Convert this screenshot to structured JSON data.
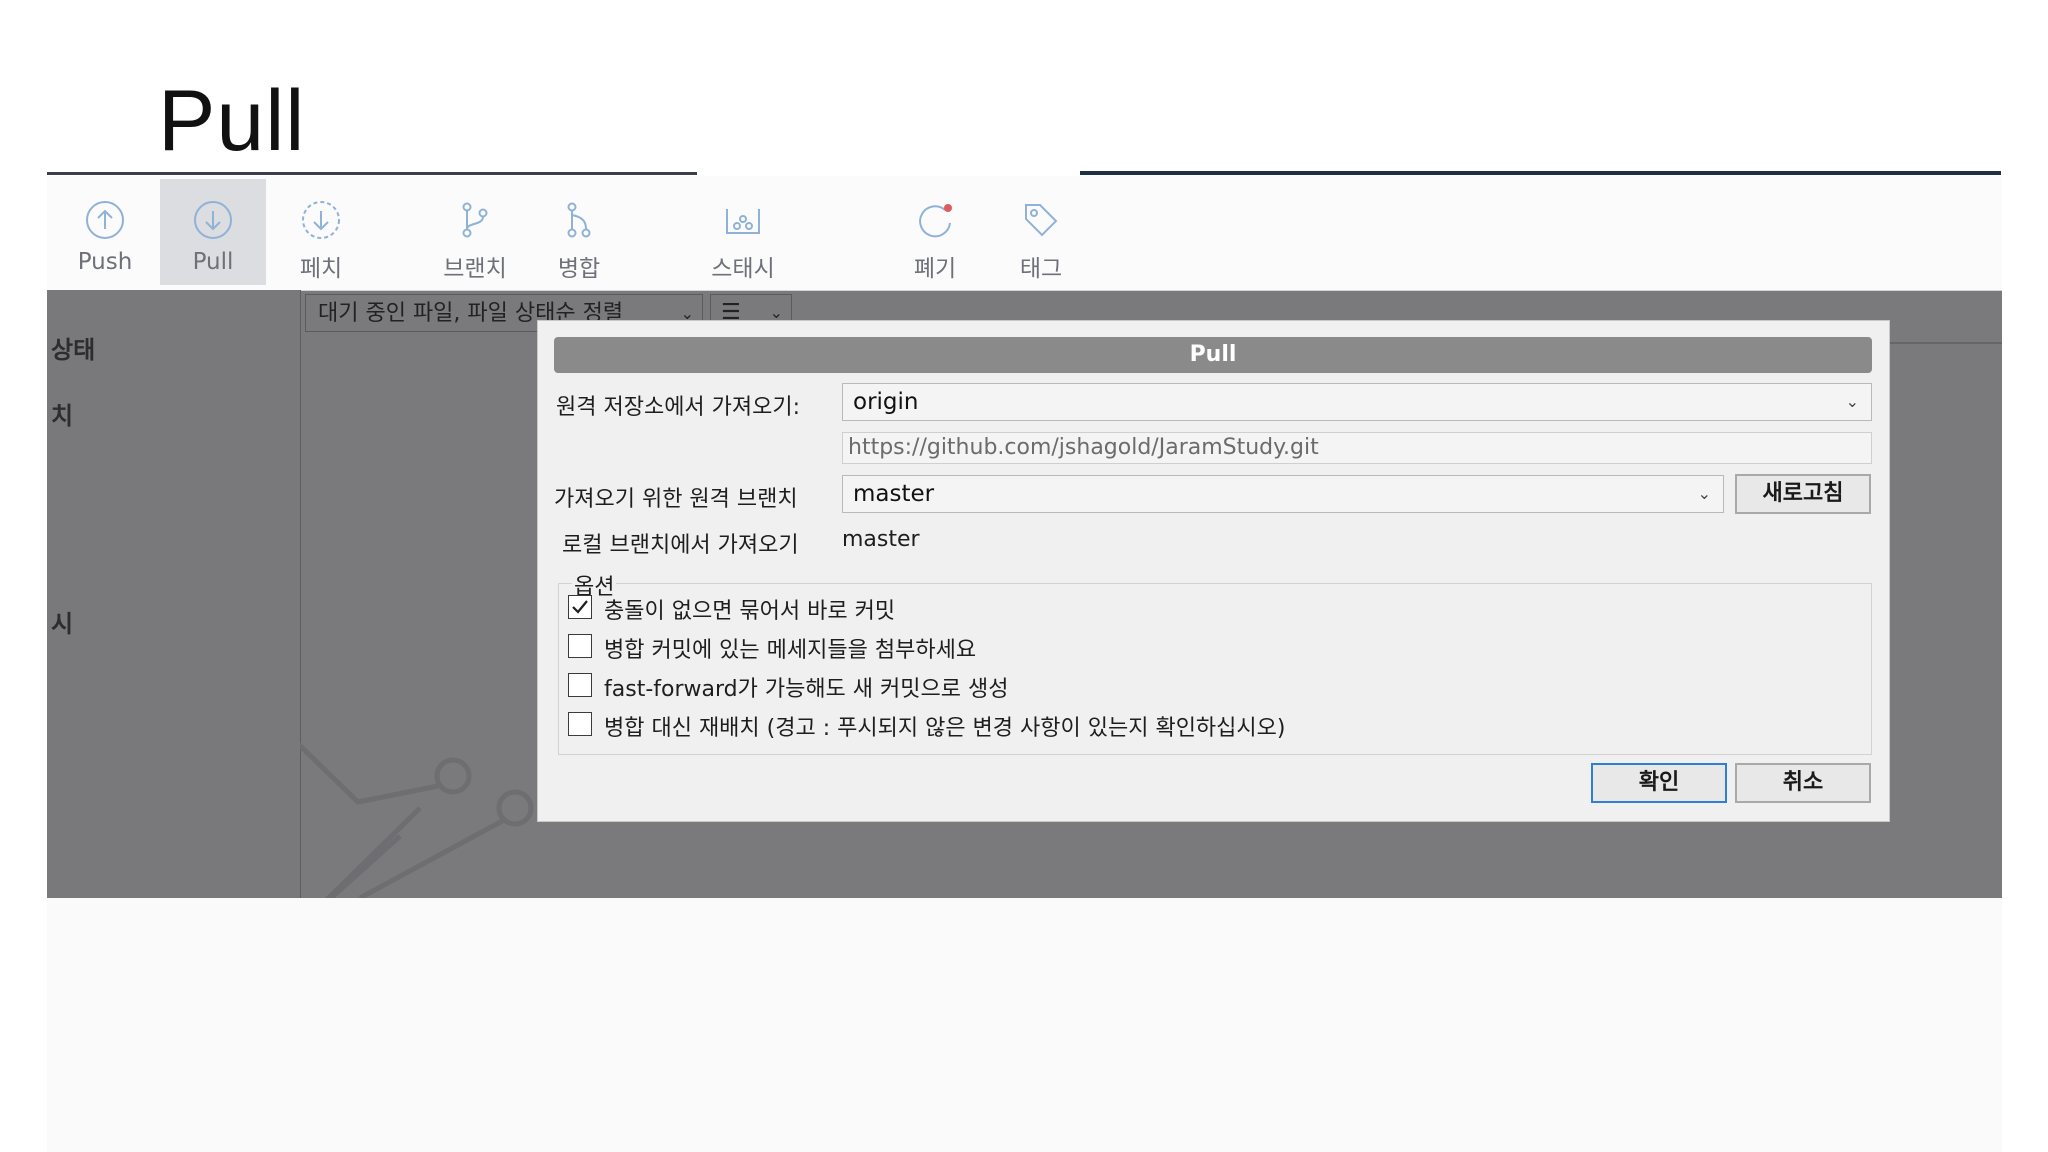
{
  "slide": {
    "title": "Pull"
  },
  "toolbar": {
    "items": [
      {
        "label": "Push",
        "icon": "push-icon"
      },
      {
        "label": "Pull",
        "icon": "pull-icon",
        "active": true
      },
      {
        "label": "페치",
        "icon": "fetch-icon"
      },
      {
        "label": "브랜치",
        "icon": "branch-icon"
      },
      {
        "label": "병합",
        "icon": "merge-icon"
      },
      {
        "label": "스태시",
        "icon": "stash-icon"
      },
      {
        "label": "폐기",
        "icon": "discard-icon"
      },
      {
        "label": "태그",
        "icon": "tag-icon"
      }
    ]
  },
  "left_panel": {
    "labels": [
      "상태",
      "치",
      "시"
    ]
  },
  "filter": {
    "value": "대기 중인 파일, 파일 상태순 정렬",
    "view_icon": "list-icon"
  },
  "dialog": {
    "title": "Pull",
    "remote_label": "원격 저장소에서 가져오기:",
    "remote_value": "origin",
    "remote_url": "https://github.com/jshagold/JaramStudy.git",
    "branch_label": "가져오기 위한 원격 브랜치",
    "branch_value": "master",
    "refresh_label": "새로고침",
    "local_label": "로컬 브랜치에서 가져오기",
    "local_value": "master",
    "options_label": "옵션",
    "options": [
      {
        "label": "충돌이 없으면 묶어서 바로 커밋",
        "checked": true
      },
      {
        "label": "병합 커밋에 있는 메세지들을 첨부하세요",
        "checked": false
      },
      {
        "label": "fast-forward가 가능해도 새 커밋으로 생성",
        "checked": false
      },
      {
        "label": "병합 대신 재배치 (경고 : 푸시되지 않은 변경 사항이 있는지 확인하십시오)",
        "checked": false
      }
    ],
    "ok_label": "확인",
    "cancel_label": "취소"
  },
  "colors": {
    "accent": "#2f7fd4",
    "overlay": "#7a797c",
    "toolbar_icon": "#8fb2d6"
  }
}
